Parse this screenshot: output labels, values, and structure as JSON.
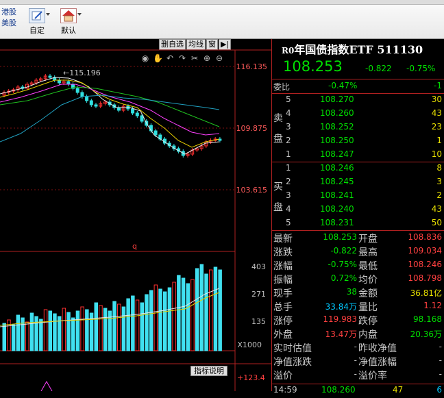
{
  "toolbar": {
    "left_items": [
      "港股",
      "美股"
    ],
    "buttons": [
      {
        "label": "自定"
      },
      {
        "label": "默认"
      }
    ]
  },
  "chart": {
    "subtoolbar": [
      "删自选",
      "均线",
      "窗"
    ],
    "price_labels": [
      "116.135",
      "109.875",
      "103.615"
    ],
    "high_marker": "115.196",
    "q_label": "q",
    "volume_labels": [
      "403",
      "271",
      "135",
      "X1000"
    ],
    "indicator_button": "指标说明",
    "indicator_value": "+123.4"
  },
  "quote": {
    "code": "R0",
    "name": "年国债指数ETF 511130",
    "price": "108.253",
    "change": "-0.822",
    "pct": "-0.75%",
    "weibi_label": "委比",
    "weibi_pct": "-0.47%",
    "weibi_val": "-1",
    "sell_label": "卖盘",
    "buy_label": "买盘",
    "sell": [
      {
        "n": "5",
        "p": "108.270",
        "v": "30"
      },
      {
        "n": "4",
        "p": "108.260",
        "v": "43"
      },
      {
        "n": "3",
        "p": "108.252",
        "v": "23"
      },
      {
        "n": "2",
        "p": "108.250",
        "v": "1"
      },
      {
        "n": "1",
        "p": "108.247",
        "v": "10"
      }
    ],
    "buy": [
      {
        "n": "1",
        "p": "108.246",
        "v": "8"
      },
      {
        "n": "2",
        "p": "108.245",
        "v": "3"
      },
      {
        "n": "3",
        "p": "108.241",
        "v": "2"
      },
      {
        "n": "4",
        "p": "108.240",
        "v": "43"
      },
      {
        "n": "5",
        "p": "108.231",
        "v": "50"
      }
    ],
    "stats": [
      {
        "l1": "最新",
        "v1": "108.253",
        "l2": "开盘",
        "v2": "108.836"
      },
      {
        "l1": "涨跌",
        "v1": "-0.822",
        "l2": "最高",
        "v2": "109.034"
      },
      {
        "l1": "涨幅",
        "v1": "-0.75%",
        "l2": "最低",
        "v2": "108.246"
      },
      {
        "l1": "振幅",
        "v1": "0.72%",
        "l2": "均价",
        "v2": "108.798"
      },
      {
        "l1": "现手",
        "v1": "38",
        "l2": "金额",
        "v2": "36.81亿"
      },
      {
        "l1": "总手",
        "v1": "33.84万",
        "l2": "量比",
        "v2": "1.12"
      },
      {
        "l1": "涨停",
        "v1": "119.983",
        "l2": "跌停",
        "v2": "98.168"
      },
      {
        "l1": "外盘",
        "v1": "13.47万",
        "l2": "内盘",
        "v2": "20.36万"
      },
      {
        "l1": "实时估值",
        "v1": "-",
        "l2": "昨收净值",
        "v2": "-"
      },
      {
        "l1": "净值涨跌",
        "v1": "-",
        "l2": "净值涨幅",
        "v2": "-"
      },
      {
        "l1": "溢价",
        "v1": "-",
        "l2": "溢价率",
        "v2": "-"
      }
    ],
    "tick": {
      "time": "14:59",
      "price": "108.260",
      "vol": "47",
      "n": "6"
    }
  }
}
